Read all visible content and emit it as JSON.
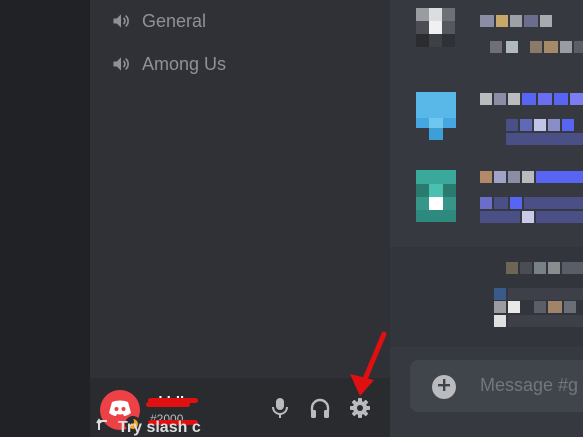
{
  "channels": [
    {
      "label": "General",
      "icon": "speaker-icon"
    },
    {
      "label": "Among Us",
      "icon": "speaker-icon"
    }
  ],
  "user": {
    "name": "akhlk",
    "discriminator": "#2000",
    "status": "idle",
    "avatar_color": "#ed4245",
    "name_redacted": true
  },
  "controls": [
    {
      "name": "microphone",
      "icon": "microphone-icon"
    },
    {
      "name": "headphones",
      "icon": "headphones-icon"
    },
    {
      "name": "settings",
      "icon": "gear-icon"
    }
  ],
  "composer": {
    "placeholder": "Message #g"
  },
  "hint": {
    "text": "Try slash c"
  },
  "colors": {
    "server_rail": "#202225",
    "sidebar": "#2f3136",
    "user_panel": "#292b2f",
    "chat": "#36393f",
    "composer": "#40444b",
    "annotation_arrow": "#e01010",
    "redaction_scribble": "#e01010"
  }
}
